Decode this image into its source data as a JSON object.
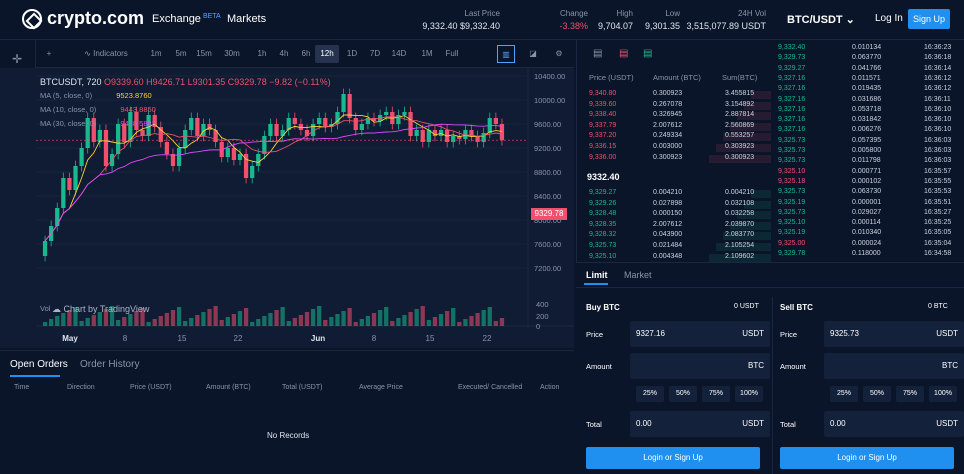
{
  "header": {
    "brand": "crypto.com",
    "nav_exchange": "Exchange",
    "nav_beta": "BETA",
    "nav_markets": "Markets",
    "stats": [
      {
        "label": "Last Price",
        "value": "9,332.40  $9,332.40",
        "color": "#dfe5f0"
      },
      {
        "label": "Change",
        "value": "-3.38%",
        "color": "#f0506e"
      },
      {
        "label": "High",
        "value": "9,704.07",
        "color": "#dfe5f0"
      },
      {
        "label": "Low",
        "value": "9,301.35",
        "color": "#dfe5f0"
      },
      {
        "label": "24H Vol",
        "value": "3,515,077.89 USDT",
        "color": "#dfe5f0"
      }
    ],
    "pair": "BTC/USDT",
    "login": "Log In",
    "signup": "Sign Up"
  },
  "chart_toolbar": {
    "indicators": "Indicators",
    "timeframes": [
      "1m",
      "5m",
      "15m",
      "30m",
      "1h",
      "4h",
      "6h",
      "12h",
      "1D",
      "7D",
      "14D",
      "1M",
      "Full"
    ],
    "active": "12h"
  },
  "chart_legend": {
    "symbol": "BTCUSDT, 720",
    "open": "O9339.60",
    "high": "H9426.71",
    "low": "L9301.35",
    "close": "C9329.78",
    "change": "−9.82 (−0.11%)",
    "ma1": "MA (5, close, 0)",
    "ma1_val": "9523.8760",
    "ma2": "MA (10, close, 0)",
    "ma2_val": "9443.8850",
    "ma3": "MA (30, close, 0)",
    "ma3_val": "9468.5883",
    "volume": "Vol",
    "watermark": "Chart by TradingView",
    "last_tag": "9329.78"
  },
  "chart_data": {
    "type": "candlestick",
    "y_ticks": [
      "10400.00",
      "10000.00",
      "9600.00",
      "9200.00",
      "8800.00",
      "8400.00",
      "8000.00",
      "7600.00",
      "7200.00"
    ],
    "vol_ticks": [
      "400",
      "200",
      "0"
    ],
    "x_ticks": [
      "May",
      "8",
      "15",
      "22",
      "Jun",
      "8",
      "15",
      "22"
    ]
  },
  "orders": {
    "tabs": [
      "Open Orders",
      "Order History"
    ],
    "columns": [
      "Time",
      "Direction",
      "Price (USDT)",
      "Amount (BTC)",
      "Total (USDT)",
      "Average Price",
      "Executed/ Cancelled",
      "Action"
    ],
    "empty": "No Records"
  },
  "orderbook": {
    "headers": [
      "Price (USDT)",
      "Amount (BTC)",
      "Sum(BTC)"
    ],
    "asks": [
      [
        "9,340.80",
        "0.300923",
        "3.455815"
      ],
      [
        "9,339.60",
        "0.267078",
        "3.154892"
      ],
      [
        "9,338.40",
        "0.326945",
        "2.887814"
      ],
      [
        "9,337.79",
        "2.007612",
        "2.560869"
      ],
      [
        "9,337.20",
        "0.249334",
        "0.553257"
      ],
      [
        "9,336.15",
        "0.003000",
        "0.303923"
      ],
      [
        "9,336.00",
        "0.300923",
        "0.300923"
      ]
    ],
    "mid": "9332.40",
    "bids": [
      [
        "9,329.27",
        "0.004210",
        "0.004210"
      ],
      [
        "9,329.26",
        "0.027898",
        "0.032108"
      ],
      [
        "9,328.48",
        "0.000150",
        "0.032258"
      ],
      [
        "9,328.35",
        "2.007612",
        "2.039870"
      ],
      [
        "9,328.32",
        "0.043900",
        "2.083770"
      ],
      [
        "9,325.73",
        "0.021484",
        "2.105254"
      ],
      [
        "9,325.10",
        "0.004348",
        "2.109602"
      ]
    ]
  },
  "trades": [
    [
      "9,332.40",
      "0.010134",
      "16:36:23",
      "g"
    ],
    [
      "9,329.73",
      "0.063770",
      "16:36:18",
      "g"
    ],
    [
      "9,329.27",
      "0.041766",
      "16:36:14",
      "g"
    ],
    [
      "9,327.16",
      "0.011571",
      "16:36:12",
      "g"
    ],
    [
      "9,327.16",
      "0.019435",
      "16:36:12",
      "g"
    ],
    [
      "9,327.16",
      "0.031686",
      "16:36:11",
      "g"
    ],
    [
      "9,327.16",
      "0.053718",
      "16:36:10",
      "g"
    ],
    [
      "9,327.16",
      "0.031842",
      "16:36:10",
      "g"
    ],
    [
      "9,327.16",
      "0.006276",
      "16:36:10",
      "g"
    ],
    [
      "9,325.73",
      "0.057395",
      "16:36:03",
      "g"
    ],
    [
      "9,325.73",
      "0.005800",
      "16:36:03",
      "g"
    ],
    [
      "9,325.73",
      "0.011798",
      "16:36:03",
      "g"
    ],
    [
      "9,325.10",
      "0.000771",
      "16:35:57",
      "r"
    ],
    [
      "9,325.18",
      "0.000102",
      "16:35:55",
      "r"
    ],
    [
      "9,325.73",
      "0.063730",
      "16:35:53",
      "g"
    ],
    [
      "9,325.19",
      "0.000001",
      "16:35:51",
      "g"
    ],
    [
      "9,325.73",
      "0.029027",
      "16:35:27",
      "g"
    ],
    [
      "9,325.10",
      "0.000114",
      "16:35:25",
      "g"
    ],
    [
      "9,325.19",
      "0.010340",
      "16:35:05",
      "g"
    ],
    [
      "9,325.00",
      "0.000024",
      "16:35:04",
      "r"
    ],
    [
      "9,329.78",
      "0.118000",
      "16:34:58",
      "g"
    ]
  ],
  "form": {
    "tabs": [
      "Limit",
      "Market"
    ],
    "buy": {
      "title": "Buy BTC",
      "bal": "0 USDT",
      "price_label": "Price",
      "price": "9327.16",
      "price_unit": "USDT",
      "amount_label": "Amount",
      "amount_unit": "BTC",
      "total_label": "Total",
      "total": "0.00",
      "total_unit": "USDT",
      "button": "Login or Sign Up"
    },
    "sell": {
      "title": "Sell BTC",
      "bal": "0 BTC",
      "price_label": "Price",
      "price": "9325.73",
      "price_unit": "USDT",
      "amount_label": "Amount",
      "amount_unit": "BTC",
      "total_label": "Total",
      "total": "0.00",
      "total_unit": "USDT",
      "button": "Login or Sign Up"
    },
    "pcts": [
      "25%",
      "50%",
      "75%",
      "100%"
    ]
  },
  "colors": {
    "up": "#18b98e",
    "down": "#f0506e",
    "accent": "#1f8ff0",
    "bg": "#0b1529"
  }
}
